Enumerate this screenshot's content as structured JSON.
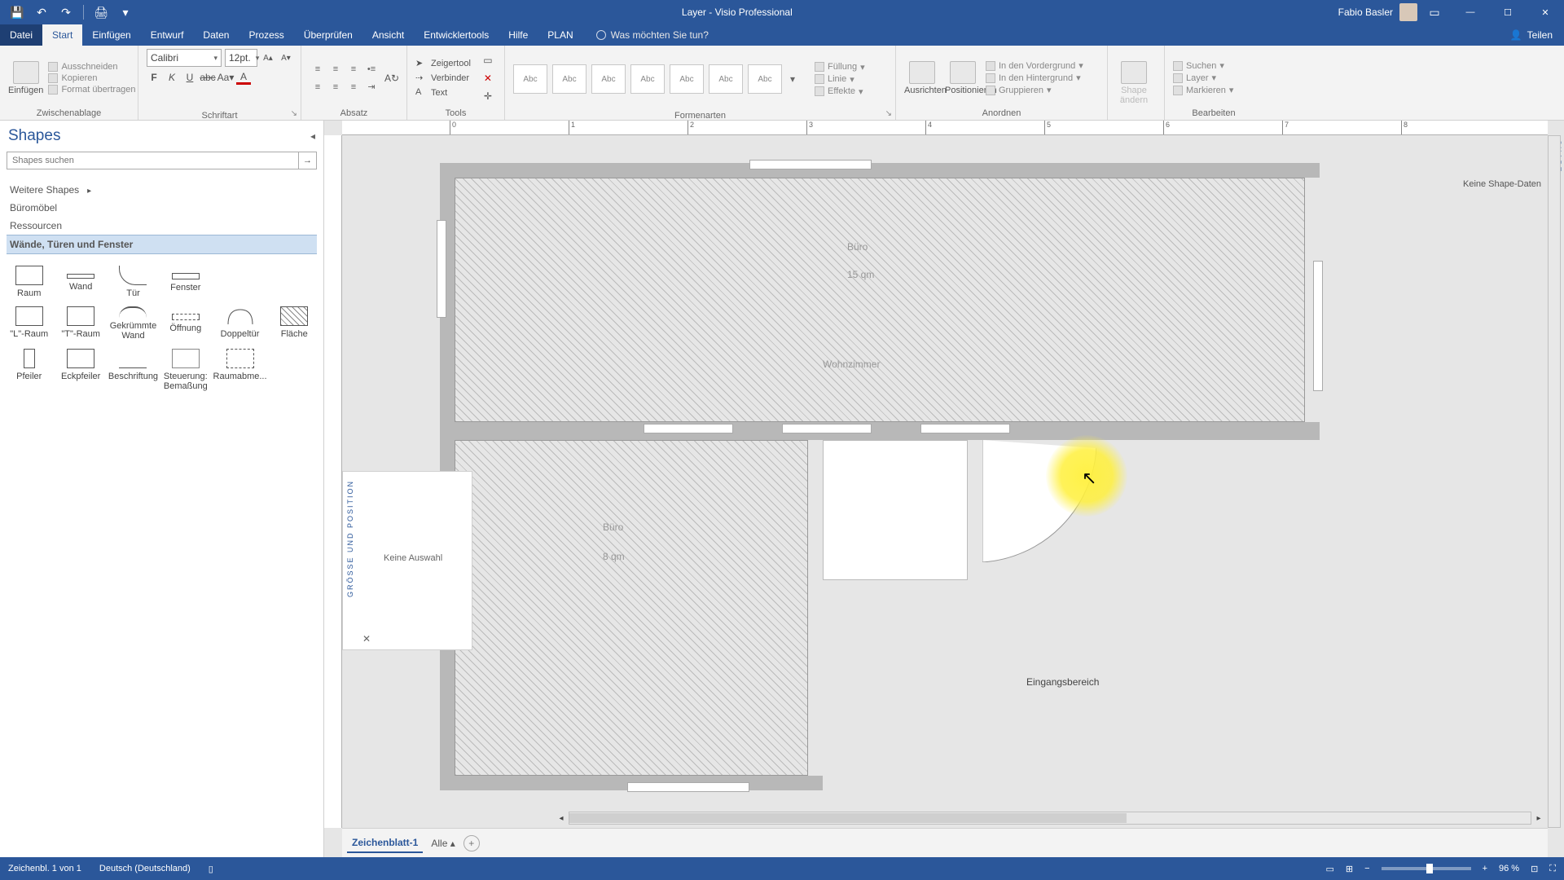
{
  "title": "Layer - Visio Professional",
  "user": "Fabio Basler",
  "quick_access": {
    "save": "💾",
    "undo": "↶",
    "redo": "↷",
    "print": "🖨"
  },
  "tabs": {
    "file": "Datei",
    "items": [
      "Start",
      "Einfügen",
      "Entwurf",
      "Daten",
      "Prozess",
      "Überprüfen",
      "Ansicht",
      "Entwicklertools",
      "Hilfe",
      "PLAN"
    ],
    "active": "Start",
    "tell_me": "Was möchten Sie tun?",
    "share": "Teilen"
  },
  "ribbon": {
    "clipboard": {
      "label": "Zwischenablage",
      "paste": "Einfügen",
      "cut": "Ausschneiden",
      "copy": "Kopieren",
      "format": "Format übertragen"
    },
    "font": {
      "label": "Schriftart",
      "name": "Calibri",
      "size": "12pt."
    },
    "paragraph": {
      "label": "Absatz"
    },
    "tools": {
      "label": "Tools",
      "pointer": "Zeigertool",
      "connector": "Verbinder",
      "text": "Text"
    },
    "styles": {
      "label": "Formenarten",
      "abc": "Abc",
      "fill": "Füllung",
      "line": "Linie",
      "effects": "Effekte"
    },
    "arrange": {
      "label": "Anordnen",
      "align": "Ausrichten",
      "position": "Positionieren",
      "front": "In den Vordergrund",
      "back": "In den Hintergrund",
      "group": "Gruppieren"
    },
    "shape_change": {
      "label": "Shape ändern"
    },
    "edit": {
      "label": "Bearbeiten",
      "find": "Suchen",
      "layer": "Layer",
      "select": "Markieren"
    }
  },
  "shapes": {
    "title": "Shapes",
    "search_placeholder": "Shapes suchen",
    "more": "Weitere Shapes",
    "stencils": [
      "Büromöbel",
      "Ressourcen",
      "Wände, Türen und Fenster"
    ],
    "active_stencil": "Wände, Türen und Fenster",
    "items": [
      "Raum",
      "Wand",
      "Tür",
      "Fenster",
      "\"L\"-Raum",
      "\"T\"-Raum",
      "Gekrümmte Wand",
      "Öffnung",
      "Doppeltür",
      "Fläche",
      "Pfeiler",
      "Eckpfeiler",
      "Beschriftung",
      "Steuerung: Bemaßung",
      "Raumabme..."
    ]
  },
  "canvas": {
    "ruler_h": [
      "0",
      "1",
      "2",
      "3",
      "4",
      "5",
      "6",
      "7",
      "8"
    ],
    "rooms": {
      "buero": "Büro",
      "buero_area": "15 qm",
      "wohn": "Wohnzimmer",
      "buero2": "Büro",
      "buero2_area": "8 qm",
      "eingang": "Eingangsbereich"
    },
    "size_panel": {
      "title": "GRÖSSE UND POSITION",
      "msg": "Keine Auswahl"
    },
    "shape_data": {
      "title": "SHAPE-DATEN...",
      "msg": "Keine Shape-Daten"
    },
    "sheet": "Zeichenblatt-1",
    "all": "Alle"
  },
  "status": {
    "page": "Zeichenbl. 1 von 1",
    "lang": "Deutsch (Deutschland)",
    "zoom": "96 %"
  }
}
